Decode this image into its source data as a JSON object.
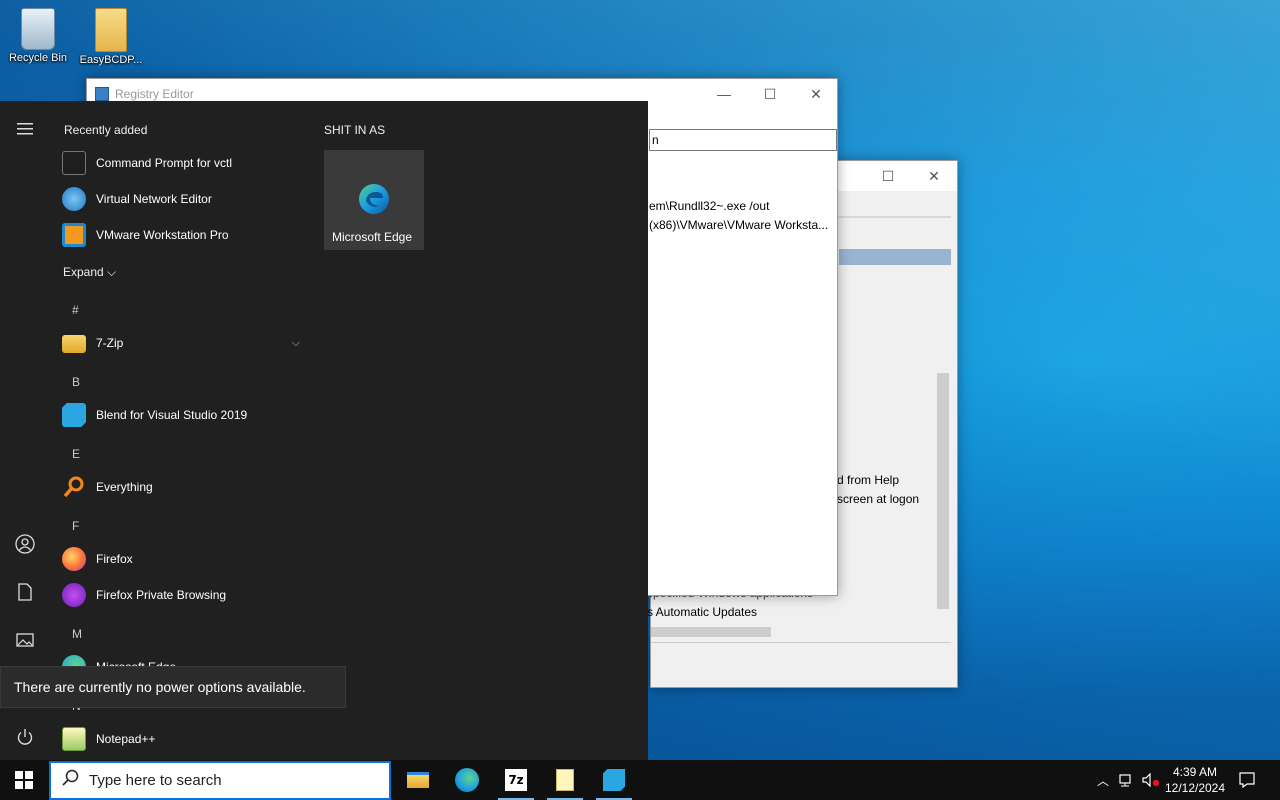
{
  "desktop": {
    "icons": [
      {
        "label": "Recycle Bin",
        "icon": "recycle-bin-icon"
      },
      {
        "label": "EasyBCDP...",
        "icon": "folder-icon"
      }
    ]
  },
  "registry_window": {
    "title": "Registry Editor",
    "address_fragment": "n",
    "rows": [
      "em\\Rundll32~.exe /out",
      "(x86)\\VMware\\VMware Worksta..."
    ],
    "controls": {
      "minimize": "—",
      "maximize": "☐",
      "close": "✕"
    }
  },
  "back_window": {
    "rows": [
      "d from Help",
      "screen at logon",
      "specified Windows applications",
      "s Automatic Updates"
    ],
    "controls": {
      "maximize": "☐",
      "close": "✕"
    }
  },
  "start_menu": {
    "recently_added_title": "Recently added",
    "recent_apps": [
      {
        "label": "Command Prompt for vctl",
        "icon": "terminal-icon",
        "color": "#1e1e1e"
      },
      {
        "label": "Virtual Network Editor",
        "icon": "globe-icon",
        "color": "#2d8fd5"
      },
      {
        "label": "VMware Workstation Pro",
        "icon": "vmware-icon",
        "color": "#f29a1d"
      }
    ],
    "expand_label": "Expand",
    "groups": [
      {
        "letter": "#",
        "apps": [
          {
            "label": "7-Zip",
            "icon": "folder-icon",
            "color": "#e9bc3c",
            "has_chevron": true
          }
        ]
      },
      {
        "letter": "B",
        "apps": [
          {
            "label": "Blend for Visual Studio 2019",
            "icon": "blend-icon",
            "color": "#2aa6e0"
          }
        ]
      },
      {
        "letter": "E",
        "apps": [
          {
            "label": "Everything",
            "icon": "magnifier-icon",
            "color": "#f3871e"
          }
        ]
      },
      {
        "letter": "F",
        "apps": [
          {
            "label": "Firefox",
            "icon": "firefox-icon",
            "color": "#ff7139"
          },
          {
            "label": "Firefox Private Browsing",
            "icon": "firefox-private-icon",
            "color": "#8c3bd6"
          }
        ]
      },
      {
        "letter": "M",
        "apps": [
          {
            "label": "Microsoft Edge",
            "icon": "edge-icon",
            "color": "#1b9de2"
          }
        ]
      },
      {
        "letter": "N",
        "apps": [
          {
            "label": "Notepad++",
            "icon": "notepadpp-icon",
            "color": "#9ccc65"
          }
        ]
      }
    ],
    "tiles_title": "SHIT IN AS",
    "tiles": [
      {
        "label": "Microsoft Edge",
        "icon": "edge-icon"
      }
    ],
    "power_tooltip": "There are currently no power options available.",
    "rail": [
      "hamburger-icon",
      "user-icon",
      "document-icon",
      "pictures-icon",
      "power-icon"
    ]
  },
  "taskbar": {
    "search_placeholder": "Type here to search",
    "apps": [
      "file-explorer-icon",
      "edge-icon",
      "7zip-icon",
      "notepad-icon",
      "blend-icon"
    ],
    "time": "4:39 AM",
    "date": "12/12/2024"
  }
}
